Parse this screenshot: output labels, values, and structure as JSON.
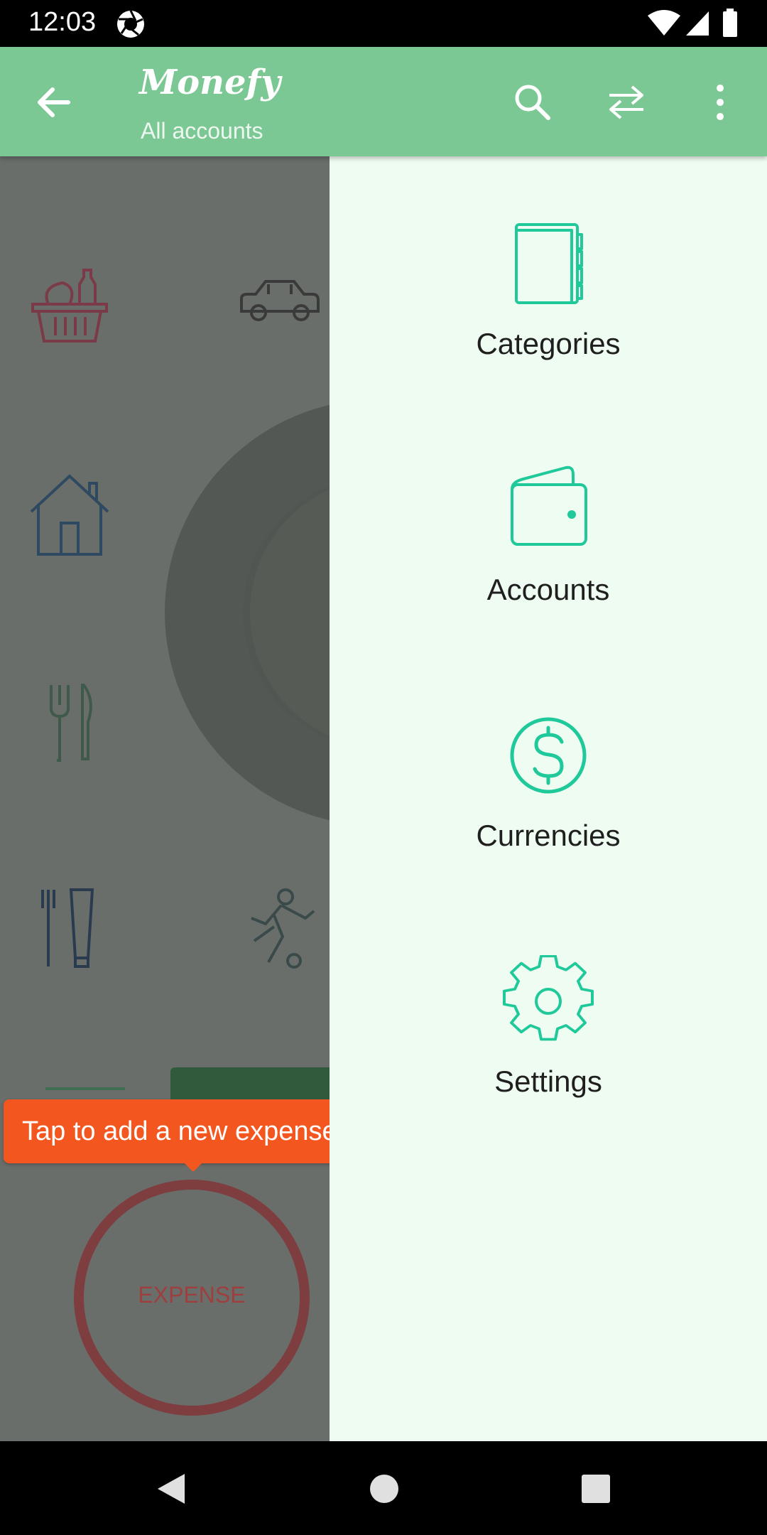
{
  "status_bar": {
    "time": "12:03"
  },
  "app_bar": {
    "title": "Monefy",
    "subtitle": "All accounts"
  },
  "drawer": {
    "items": [
      {
        "label": "Categories",
        "icon": "notebook-icon"
      },
      {
        "label": "Accounts",
        "icon": "wallet-icon"
      },
      {
        "label": "Currencies",
        "icon": "dollar-circle-icon"
      },
      {
        "label": "Settings",
        "icon": "gear-icon"
      }
    ]
  },
  "tooltip": {
    "text": "Tap to add a new expense record"
  },
  "expense_button": {
    "label": "EXPENSE"
  },
  "colors": {
    "app_bar": "#7cc894",
    "drawer_bg": "#effcf2",
    "accent_icon": "#1fc99a",
    "tooltip_bg": "#f4561f",
    "expense_ring": "#7e3d3f"
  }
}
